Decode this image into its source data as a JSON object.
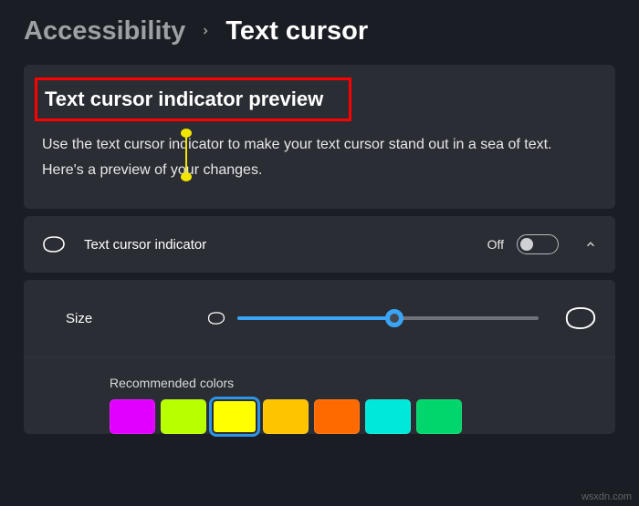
{
  "breadcrumb": {
    "parent": "Accessibility",
    "current": "Text cursor"
  },
  "preview": {
    "title": "Text cursor indicator preview",
    "body": "Use the text cursor indicator to make your text cursor stand out in a sea of text. Here's a preview of your changes."
  },
  "indicator": {
    "label": "Text cursor indicator",
    "state_label": "Off",
    "state_on": false
  },
  "size": {
    "label": "Size",
    "value_percent": 52
  },
  "colors": {
    "label": "Recommended colors",
    "swatches": [
      {
        "name": "magenta",
        "hex": "#e100ff",
        "selected": false
      },
      {
        "name": "lime",
        "hex": "#b8ff00",
        "selected": false
      },
      {
        "name": "yellow",
        "hex": "#ffff00",
        "selected": true
      },
      {
        "name": "gold",
        "hex": "#ffc400",
        "selected": false
      },
      {
        "name": "orange",
        "hex": "#ff6a00",
        "selected": false
      },
      {
        "name": "aqua",
        "hex": "#00e8d8",
        "selected": false
      },
      {
        "name": "green",
        "hex": "#00d66b",
        "selected": false
      }
    ]
  },
  "watermark": "wsxdn.com"
}
